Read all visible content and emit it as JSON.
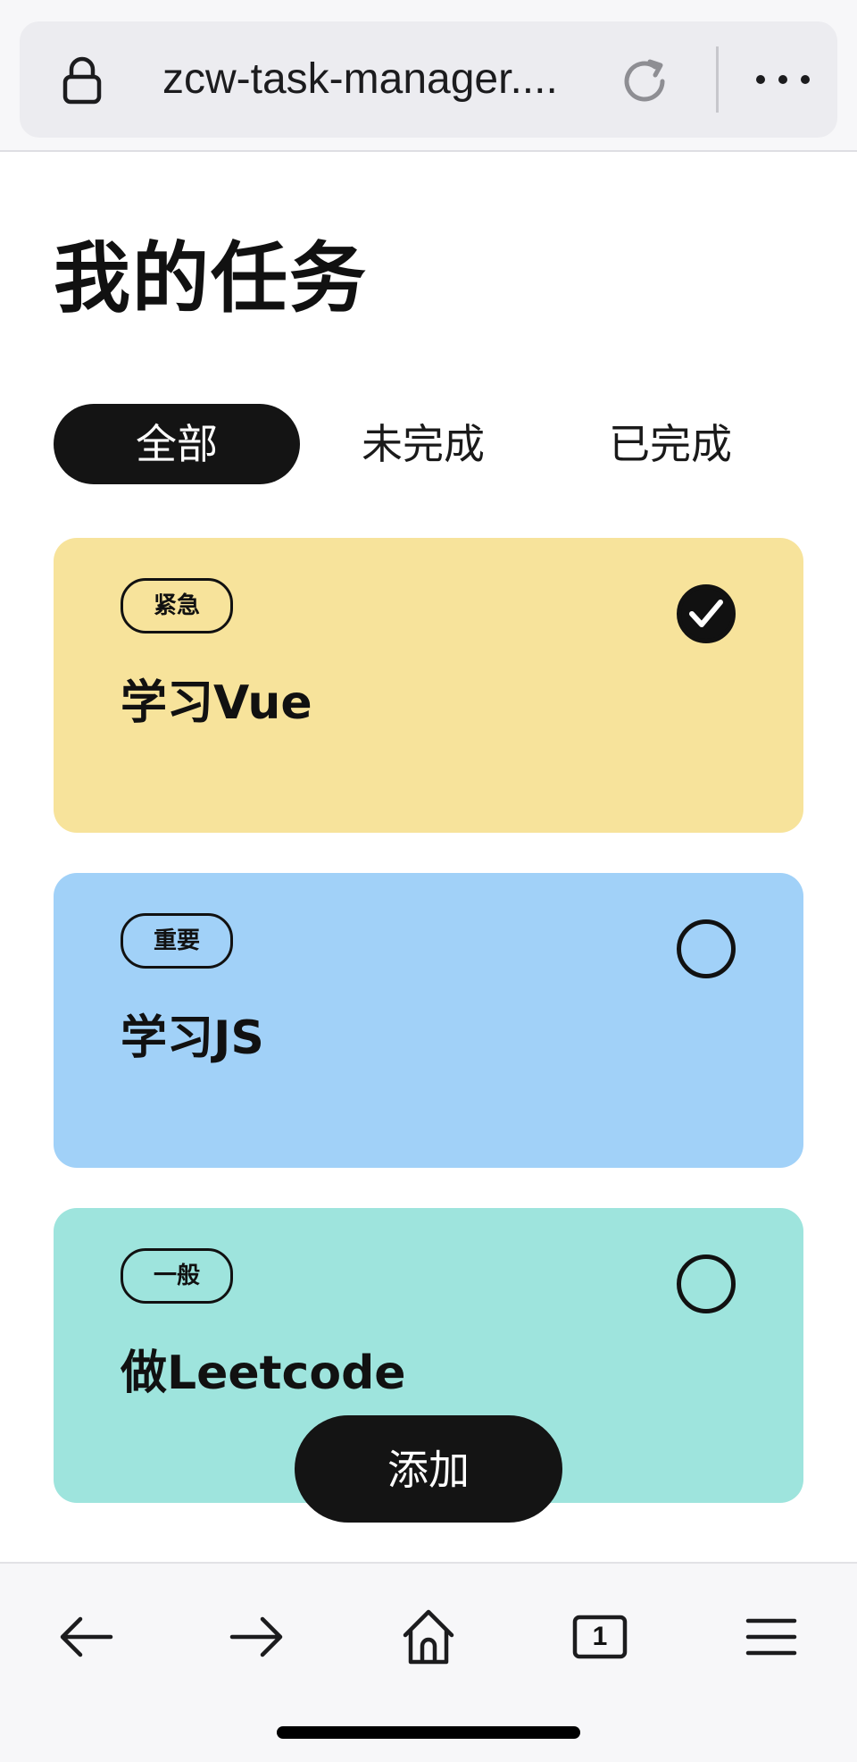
{
  "browser": {
    "url": "zcw-task-manager....",
    "tabs_count": "1",
    "icons": {
      "lock": "lock-icon",
      "reload": "reload-icon",
      "more": "more-icon",
      "back": "back-arrow-icon",
      "forward": "forward-arrow-icon",
      "home": "home-icon",
      "tabs": "tabs-icon",
      "menu": "menu-icon"
    }
  },
  "page": {
    "title": "我的任务"
  },
  "filter_tabs": [
    {
      "label": "全部",
      "active": true
    },
    {
      "label": "未完成",
      "active": false
    },
    {
      "label": "已完成",
      "active": false
    }
  ],
  "tasks": [
    {
      "tag": "紧急",
      "title": "学习Vue",
      "done": true,
      "color": "#f7e39b"
    },
    {
      "tag": "重要",
      "title": "学习JS",
      "done": false,
      "color": "#a1d1f8"
    },
    {
      "tag": "一般",
      "title": "做Leetcode",
      "done": false,
      "color": "#9ee4dd"
    }
  ],
  "add_button": {
    "label": "添加"
  },
  "colors": {
    "accent_dark": "#141414",
    "urgent": "#f7e39b",
    "important": "#a1d1f8",
    "normal": "#9ee4dd"
  }
}
